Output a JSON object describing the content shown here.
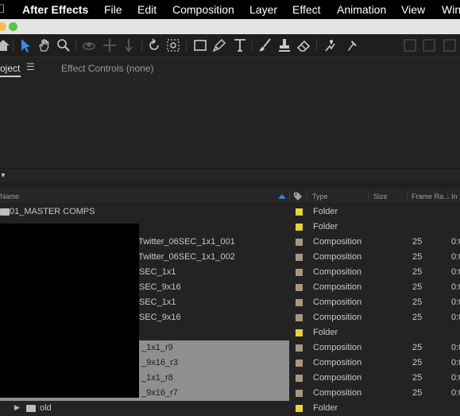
{
  "menubar": {
    "app_name": "After Effects",
    "items": [
      "File",
      "Edit",
      "Composition",
      "Layer",
      "Effect",
      "Animation",
      "View",
      "Win"
    ]
  },
  "panel": {
    "project_tab": "oject",
    "effect_controls_tab": "Effect Controls (none)"
  },
  "columns": {
    "name": "Name",
    "type": "Type",
    "size": "Size",
    "frame_rate": "Frame Ra...",
    "in_point": "In"
  },
  "rows": [
    {
      "name": "01_MASTER COMPS",
      "type": "Folder",
      "fps": "",
      "in": "",
      "color": "#e6d23a"
    },
    {
      "name": "",
      "type": "Folder",
      "fps": "",
      "in": "",
      "color": "#e6d23a"
    },
    {
      "name": "Twitter_06SEC_1x1_001",
      "type": "Composition",
      "fps": "25",
      "in": "0:0",
      "color": "#a89880"
    },
    {
      "name": "Twitter_06SEC_1x1_002",
      "type": "Composition",
      "fps": "25",
      "in": "0:0",
      "color": "#a89880"
    },
    {
      "name": "SEC_1x1",
      "type": "Composition",
      "fps": "25",
      "in": "0:0",
      "color": "#a89880"
    },
    {
      "name": "SEC_9x16",
      "type": "Composition",
      "fps": "25",
      "in": "0:0",
      "color": "#a89880"
    },
    {
      "name": "SEC_1x1",
      "type": "Composition",
      "fps": "25",
      "in": "0:0",
      "color": "#a89880"
    },
    {
      "name": "SEC_9x16",
      "type": "Composition",
      "fps": "25",
      "in": "0:0",
      "color": "#a89880"
    },
    {
      "name": "",
      "type": "Folder",
      "fps": "",
      "in": "",
      "color": "#e6d23a"
    },
    {
      "name": "_1x1_r9",
      "type": "Composition",
      "fps": "25",
      "in": "0:0",
      "color": "#a89880",
      "selected": true
    },
    {
      "name": "_9x16_r3",
      "type": "Composition",
      "fps": "25",
      "in": "0:0",
      "color": "#a89880",
      "selected": true
    },
    {
      "name": "_1x1_r8",
      "type": "Composition",
      "fps": "25",
      "in": "0:0",
      "color": "#a89880",
      "selected": true
    },
    {
      "name": "_9x16_r7",
      "type": "Composition",
      "fps": "25",
      "in": "0:0",
      "color": "#a89880",
      "selected": true
    },
    {
      "name": "old",
      "type": "Folder",
      "fps": "",
      "in": "",
      "color": "#e6d23a"
    }
  ]
}
